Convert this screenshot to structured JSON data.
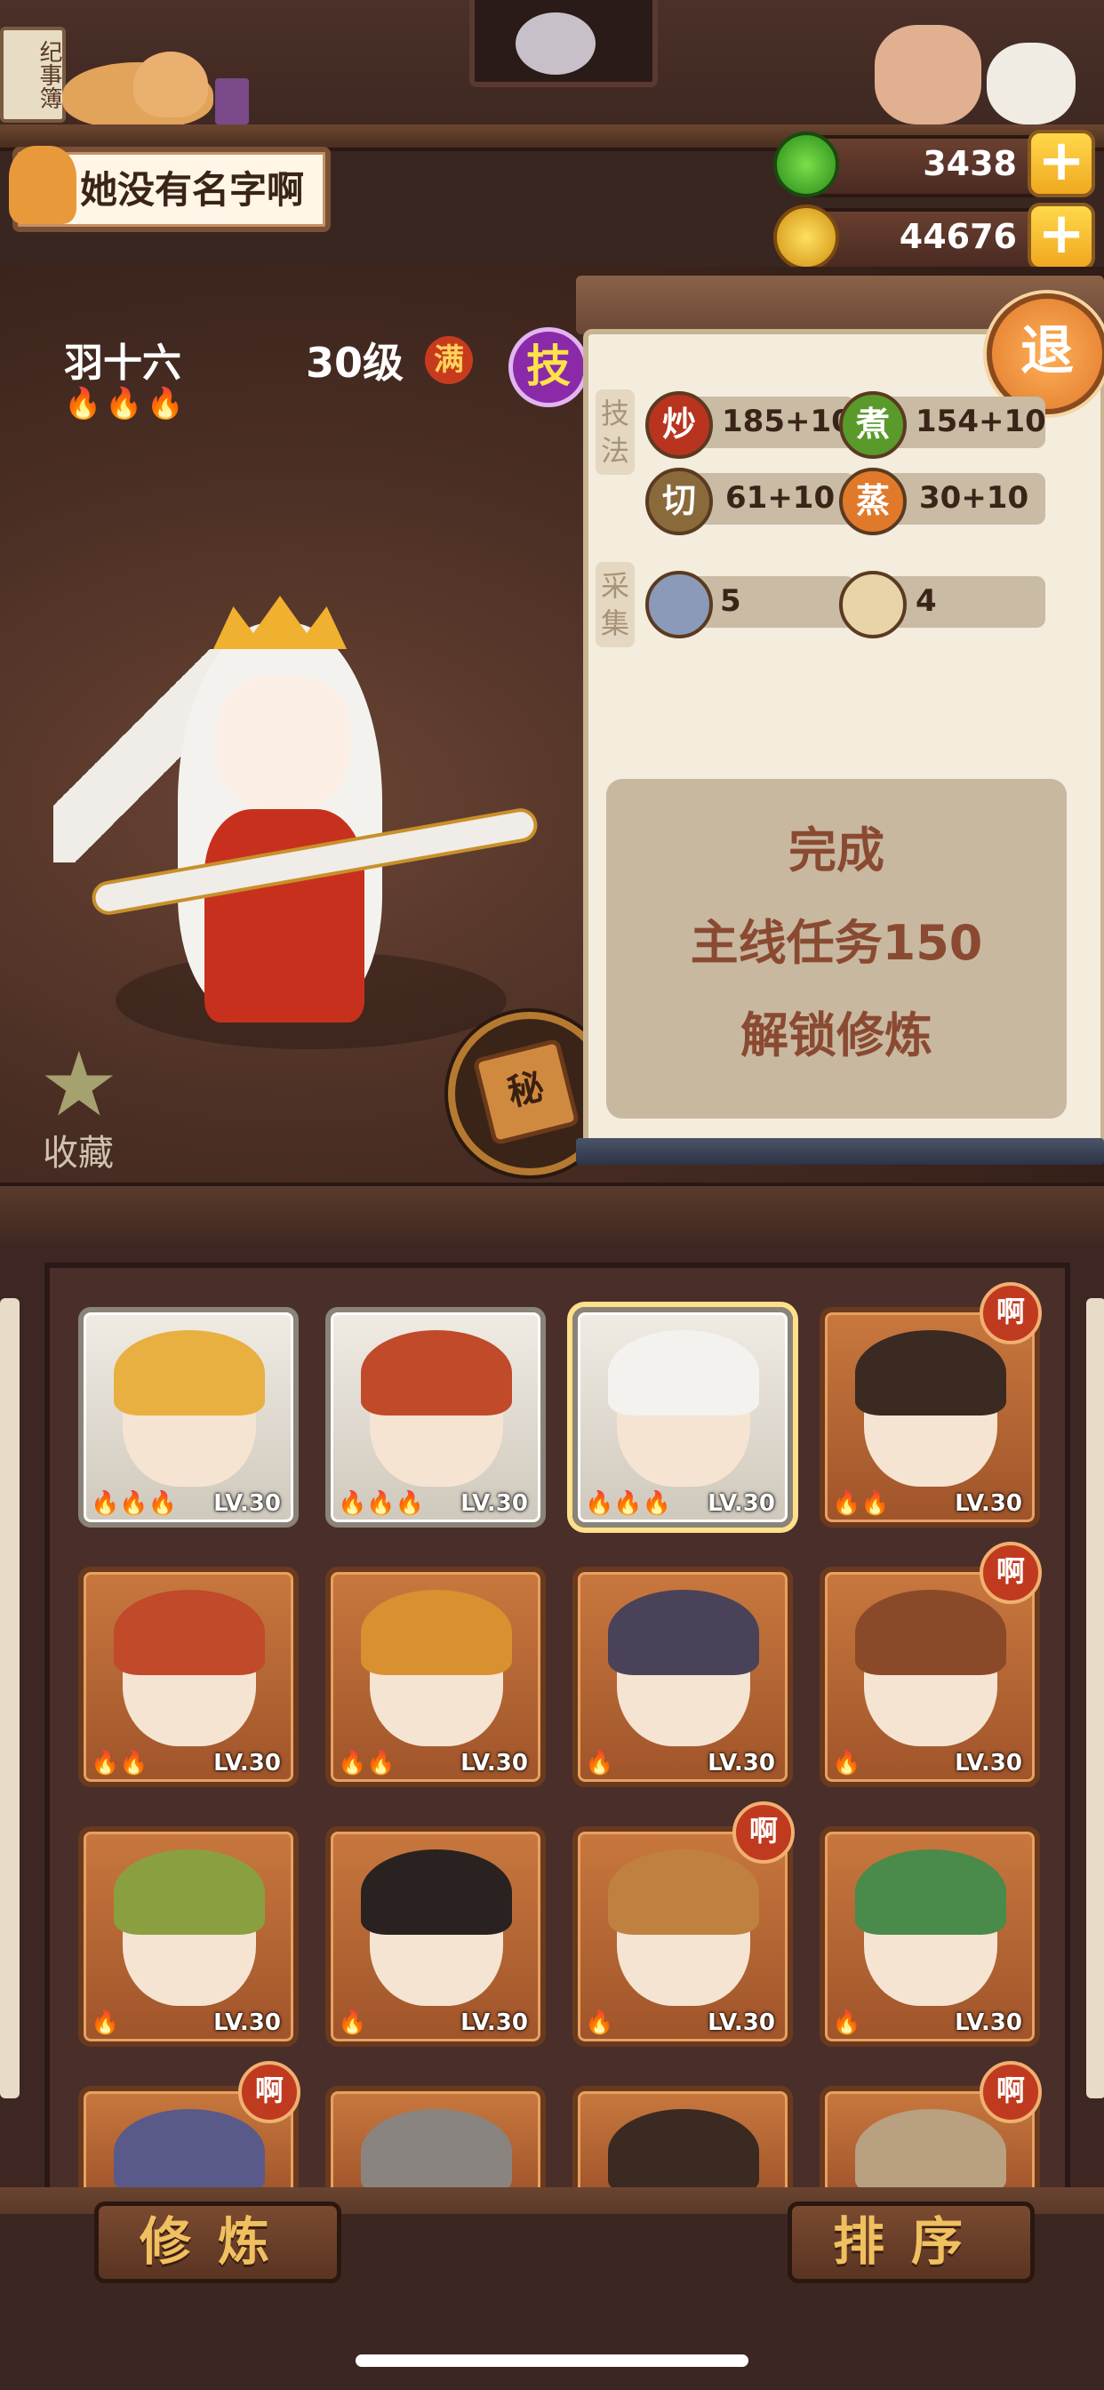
{
  "header": {
    "sign_text": "纪事簿",
    "player_name": "她没有名字啊",
    "jade_value": "3438",
    "coin_value": "44676"
  },
  "character": {
    "name": "羽十六",
    "level": "30级",
    "max_badge": "满",
    "skill_button": "技",
    "flames": "🔥🔥🔥",
    "favorite_label": "收藏",
    "secret_label": "秘"
  },
  "panel": {
    "exit_label": "退",
    "skill_section": "技法",
    "gather_section": "采集",
    "stats": [
      {
        "icon": "炒",
        "value": "185+10",
        "color": "#b8341e"
      },
      {
        "icon": "煮",
        "value": "154+10",
        "color": "#5a9a2a"
      },
      {
        "icon": "切",
        "value": "61+10",
        "color": "#8a6a3a"
      },
      {
        "icon": "蒸",
        "value": "30+10",
        "color": "#e07a2a"
      }
    ],
    "gather": [
      {
        "icon": "fish-icon",
        "value": "5"
      },
      {
        "icon": "grain-icon",
        "value": "4"
      }
    ],
    "lock_lines": [
      "完成",
      "主线任务150",
      "解锁修炼"
    ]
  },
  "cards": [
    {
      "lv": "LV.30",
      "flames": "🔥🔥🔥",
      "style": "silver",
      "hair": "#e8b040"
    },
    {
      "lv": "LV.30",
      "flames": "🔥🔥🔥",
      "style": "silver",
      "hair": "#c04a2a"
    },
    {
      "lv": "LV.30",
      "flames": "🔥🔥🔥",
      "style": "silver selected",
      "hair": "#f4f2ee"
    },
    {
      "lv": "LV.30",
      "flames": "🔥🔥",
      "style": "",
      "hair": "#3a2a22",
      "badge": "啊"
    },
    {
      "lv": "LV.30",
      "flames": "🔥🔥",
      "style": "",
      "hair": "#c04a2a"
    },
    {
      "lv": "LV.30",
      "flames": "🔥🔥",
      "style": "",
      "hair": "#d89030"
    },
    {
      "lv": "LV.30",
      "flames": "🔥",
      "style": "",
      "hair": "#4a4258"
    },
    {
      "lv": "LV.30",
      "flames": "🔥",
      "style": "",
      "hair": "#8a4a2a",
      "badge": "啊"
    },
    {
      "lv": "LV.30",
      "flames": "🔥",
      "style": "",
      "hair": "#8aa040"
    },
    {
      "lv": "LV.30",
      "flames": "🔥",
      "style": "",
      "hair": "#2a2220"
    },
    {
      "lv": "LV.30",
      "flames": "🔥",
      "style": "",
      "hair": "#c08040",
      "badge": "啊"
    },
    {
      "lv": "LV.30",
      "flames": "🔥",
      "style": "",
      "hair": "#4a8a4a"
    },
    {
      "lv": "",
      "flames": "",
      "style": "",
      "hair": "#5a5a8a",
      "badge": "啊"
    },
    {
      "lv": "",
      "flames": "",
      "style": "",
      "hair": "#8a8480"
    },
    {
      "lv": "",
      "flames": "",
      "style": "",
      "hair": "#3a2a22"
    },
    {
      "lv": "",
      "flames": "",
      "style": "",
      "hair": "#b8a080",
      "badge": "啊"
    }
  ],
  "bottom": {
    "train_label": "修炼",
    "sort_label": "排序"
  }
}
